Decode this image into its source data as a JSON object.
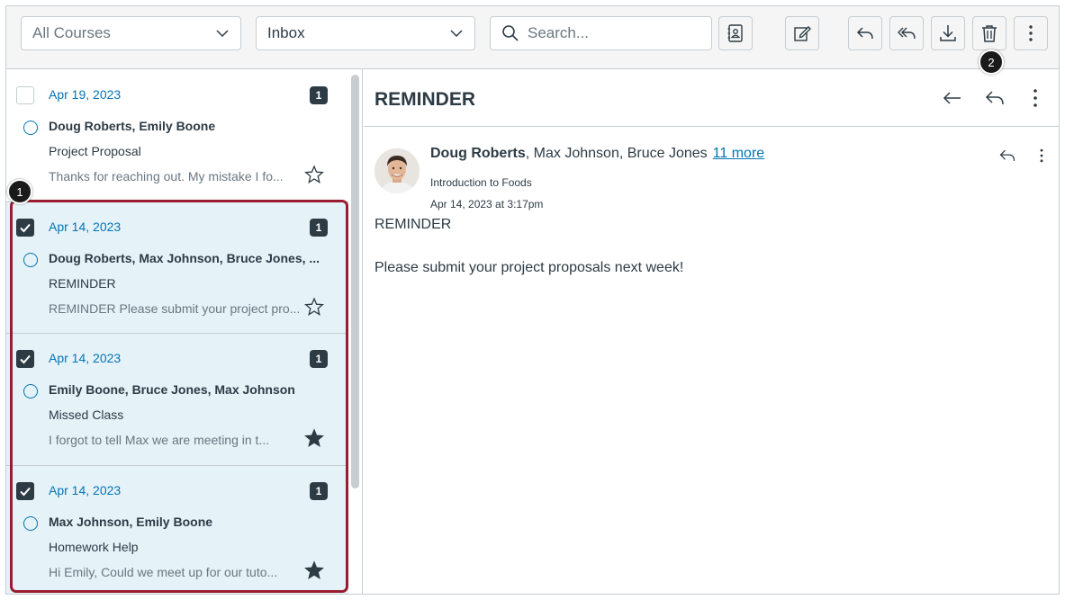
{
  "toolbar": {
    "course_filter": "All Courses",
    "mailbox_filter": "Inbox",
    "search_placeholder": "Search..."
  },
  "callouts": {
    "first": "1",
    "second": "2"
  },
  "conversations": [
    {
      "date": "Apr 19, 2023",
      "count": "1",
      "participants": "Doug Roberts, Emily Boone",
      "subject": "Project Proposal",
      "preview": "Thanks for reaching out. My mistake I fo...",
      "selected": false,
      "starred": false
    },
    {
      "date": "Apr 14, 2023",
      "count": "1",
      "participants": "Doug Roberts, Max Johnson, Bruce Jones, ...",
      "subject": "REMINDER",
      "preview": "REMINDER Please submit your project pro...",
      "selected": true,
      "starred": false
    },
    {
      "date": "Apr 14, 2023",
      "count": "1",
      "participants": "Emily Boone, Bruce Jones, Max Johnson",
      "subject": "Missed Class",
      "preview": "I forgot to tell Max we are meeting in t...",
      "selected": true,
      "starred": true
    },
    {
      "date": "Apr 14, 2023",
      "count": "1",
      "participants": "Max Johnson, Emily Boone",
      "subject": "Homework Help",
      "preview": "Hi Emily, Could we meet up for our tuto...",
      "selected": true,
      "starred": true
    }
  ],
  "message": {
    "title": "REMINDER",
    "sender": "Doug Roberts",
    "recipients": ", Max Johnson, Bruce Jones",
    "more_link": "11 more",
    "course": "Introduction to Foods",
    "sent_at": "Apr 14, 2023 at 3:17pm",
    "body_line1": "REMINDER",
    "body_line2": "Please submit your project proposals next week!"
  },
  "colors": {
    "link": "#0374b5",
    "selection_bg": "#e5f2f8",
    "selection_outline": "#9b1c31",
    "text": "#2d3b45"
  }
}
